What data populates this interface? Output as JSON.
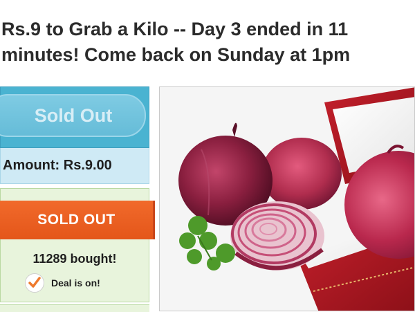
{
  "headline": {
    "line1": "Rs.9 to Grab a Kilo -- Day 3 ended in 11",
    "line2": "minutes! Come back on Sunday at 1pm"
  },
  "buy_button": {
    "label": "Sold Out"
  },
  "amount": {
    "text": "Amount: Rs.9.00"
  },
  "status": {
    "ribbon": "SOLD OUT",
    "bought": "11289 bought!",
    "deal": "Deal is on!"
  },
  "colors": {
    "buy_panel": "#4ab3d1",
    "ribbon": "#e85c1f",
    "status_panel": "#e8f4dc",
    "check": "#ee7a2d"
  },
  "icons": [
    "checkmark-icon"
  ],
  "product_image": {
    "subject": "red-onions-in-jewelry-box"
  }
}
